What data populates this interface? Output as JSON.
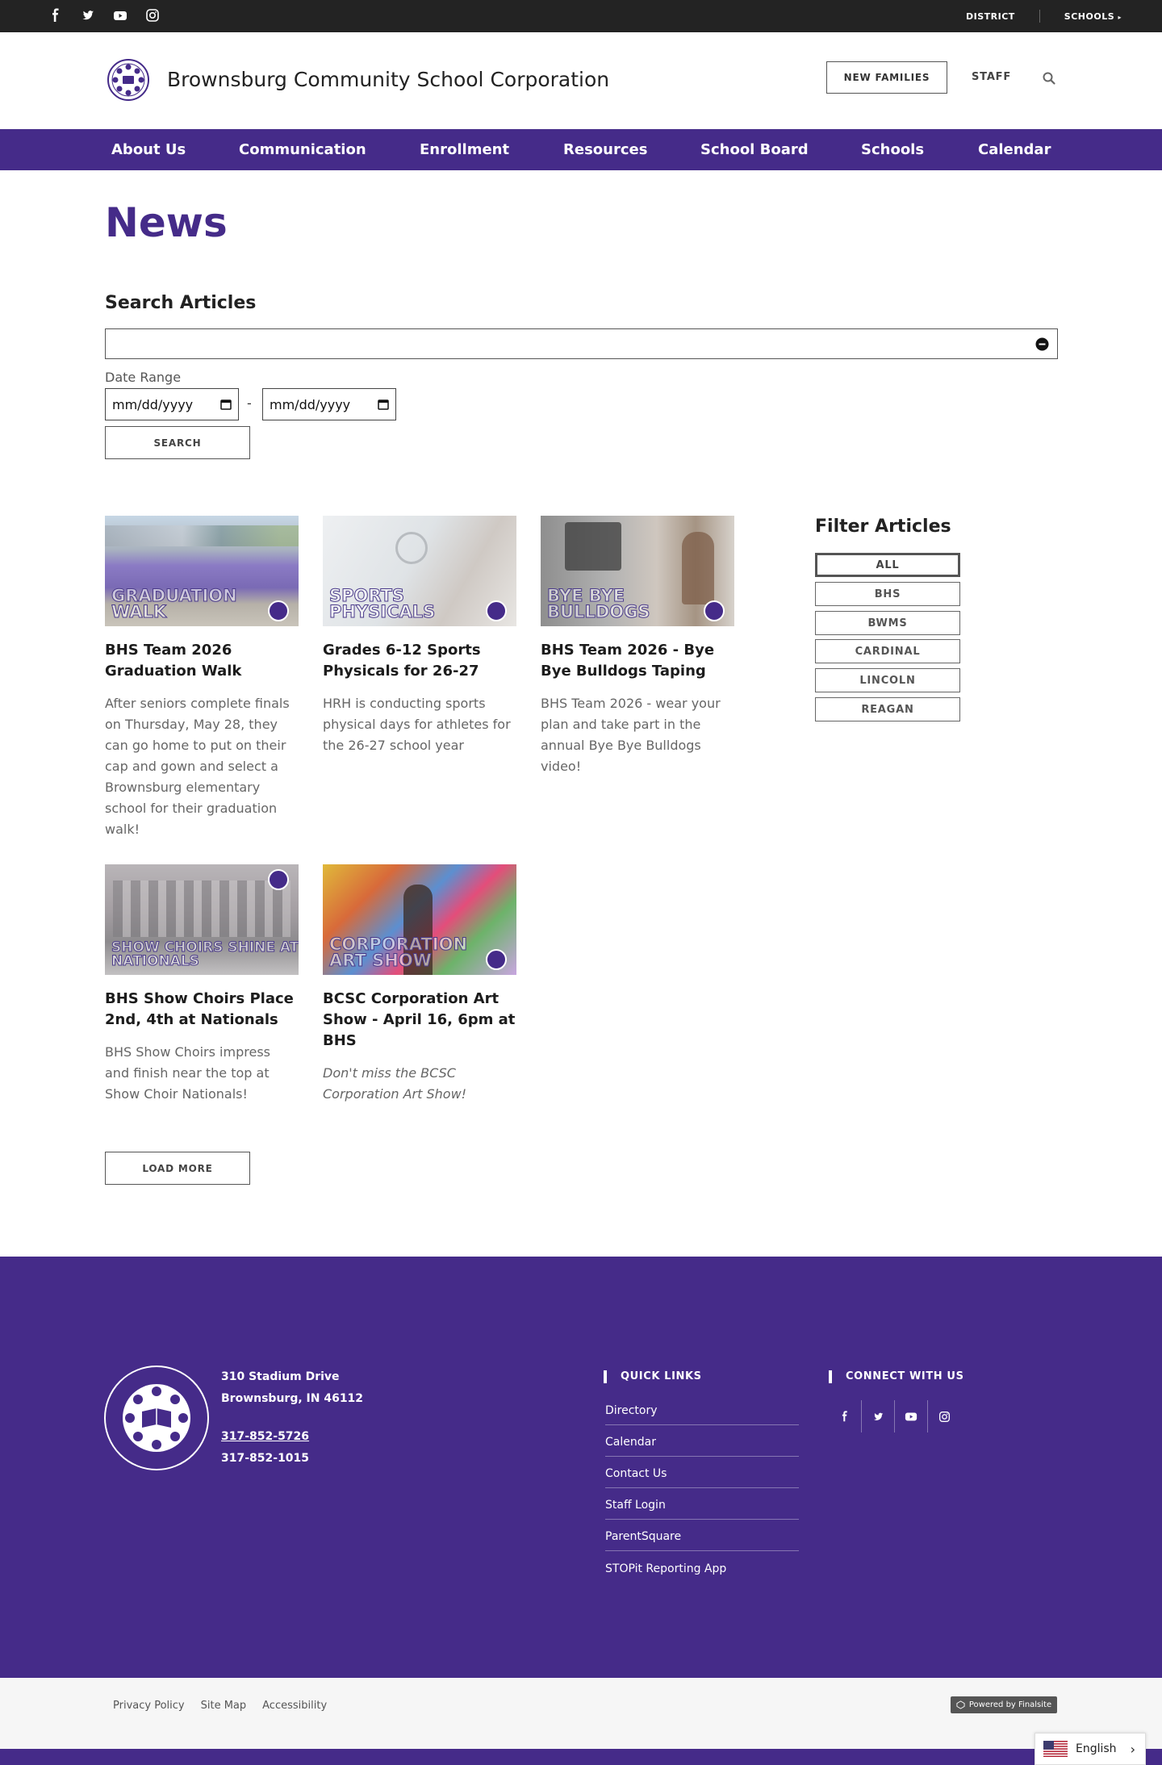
{
  "topbar": {
    "social_icons": [
      "facebook-icon",
      "twitter-icon",
      "youtube-icon",
      "instagram-icon"
    ],
    "district_label": "DISTRICT",
    "schools_label": "SCHOOLS"
  },
  "header": {
    "title": "Brownsburg Community School Corporation",
    "new_families_label": "NEW FAMILIES",
    "staff_label": "STAFF"
  },
  "nav": {
    "items": [
      "About Us",
      "Communication",
      "Enrollment",
      "Resources",
      "School Board",
      "Schools",
      "Calendar"
    ]
  },
  "main": {
    "page_title": "News",
    "search_heading": "Search Articles",
    "search_value": "",
    "date_range_label": "Date Range",
    "date_from_placeholder": "mm/dd/yyyy",
    "date_to_placeholder": "mm/dd/yyyy",
    "date_separator": "-",
    "search_button": "SEARCH",
    "load_more_button": "LOAD MORE"
  },
  "articles": [
    {
      "image_text": "GRADUATION WALK",
      "title": "BHS Team 2026 Graduation Walk",
      "summary": "After seniors complete finals on Thursday, May 28, they can go home to put on their cap and gown and select a Brownsburg elementary school for their graduation walk!"
    },
    {
      "image_text": "SPORTS PHYSICALS",
      "title": "Grades 6-12 Sports Physicals for 26-27",
      "summary": "HRH is conducting sports physical days for athletes for the 26-27 school year"
    },
    {
      "image_text": "BYE BYE BULLDOGS",
      "title": "BHS Team 2026 - Bye Bye Bulldogs Taping",
      "summary": "BHS Team 2026 - wear your plan and take part in the annual Bye Bye Bulldogs video!"
    },
    {
      "image_text": "SHOW CHOIRS SHINE AT NATIONALS",
      "title": "BHS Show Choirs Place 2nd, 4th at Nationals",
      "summary": "BHS Show Choirs impress and finish near the top at Show Choir Nationals!"
    },
    {
      "image_text": "CORPORATION ART SHOW",
      "title": "BCSC Corporation Art Show - April 16, 6pm at BHS",
      "summary": "Don't miss the BCSC Corporation Art Show!"
    }
  ],
  "filter": {
    "heading": "Filter Articles",
    "options": [
      "ALL",
      "BHS",
      "BWMS",
      "CARDINAL",
      "LINCOLN",
      "REAGAN"
    ],
    "selected": "ALL"
  },
  "footer": {
    "address_line1": "310 Stadium Drive",
    "address_line2": "Brownsburg, IN  46112",
    "phone": "317-852-5726",
    "fax": "317-852-1015",
    "quick_links_heading": "QUICK LINKS",
    "quick_links": [
      "Directory",
      "Calendar",
      "Contact Us",
      "Staff Login",
      "ParentSquare",
      "STOPit Reporting App"
    ],
    "connect_heading": "CONNECT WITH US"
  },
  "bottom": {
    "links": [
      "Privacy Policy",
      "Site Map",
      "Accessibility"
    ],
    "powered_by": "Powered by Finalsite",
    "language": "English"
  },
  "colors": {
    "brand_purple": "#452b89",
    "topbar": "#232323"
  }
}
